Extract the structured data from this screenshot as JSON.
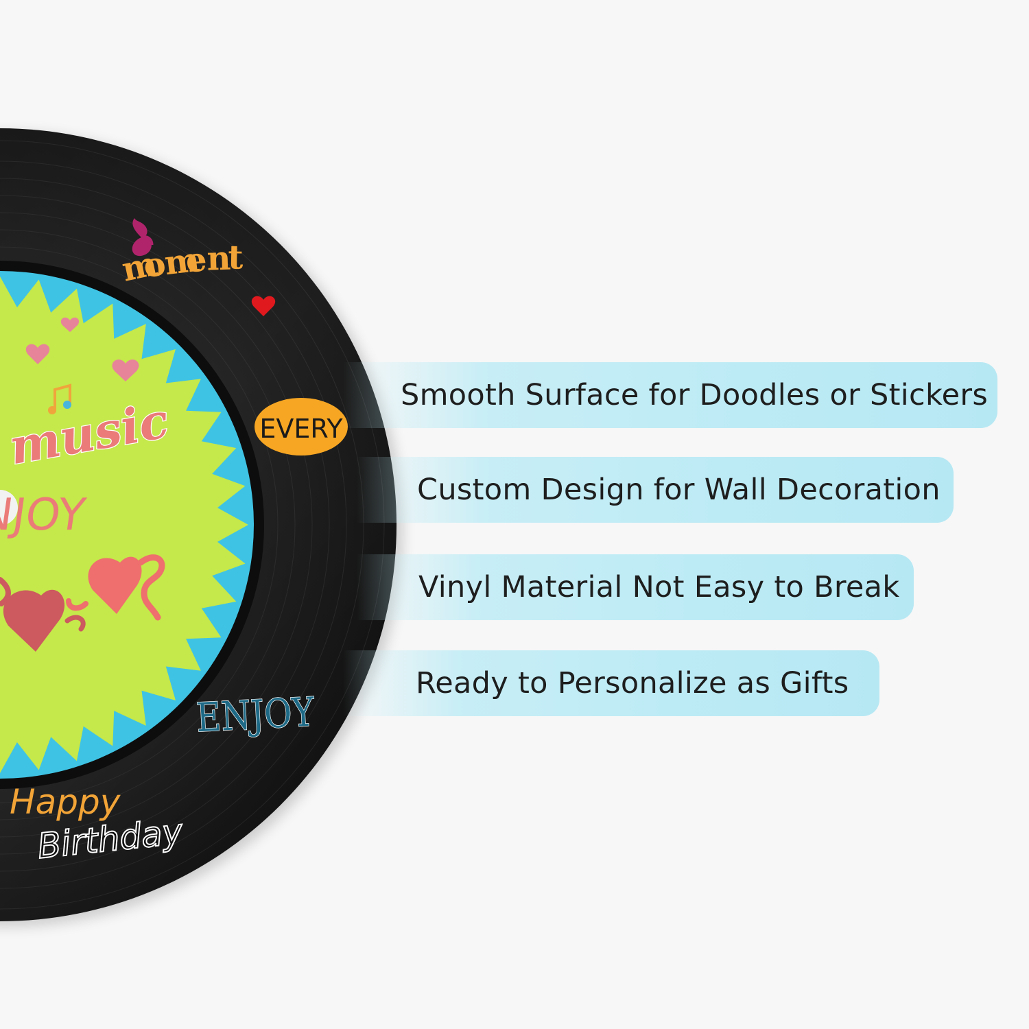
{
  "record": {
    "label_words": {
      "moment": "moment",
      "music": "music",
      "enjoy_center": "ENJOY",
      "every": "EVERY",
      "enjoy_bottom": "ENJOY",
      "happy": "Happy",
      "birthday": "Birthday"
    },
    "colors": {
      "vinyl": "#141414",
      "label_blue": "#3fc3e4",
      "label_green": "#c5e84a",
      "coral": "#ea7b78",
      "orange": "#f0a43c",
      "every_badge": "#f6a623",
      "heart_red": "#e0191e",
      "heart_pink": "#e7849a",
      "note_magenta": "#b0246c",
      "enjoy_teal": "#2b7c97"
    }
  },
  "features": [
    "Smooth Surface for Doodles or Stickers",
    "Custom Design for Wall Decoration",
    "Vinyl Material Not Easy to Break",
    "Ready to Personalize as Gifts"
  ]
}
